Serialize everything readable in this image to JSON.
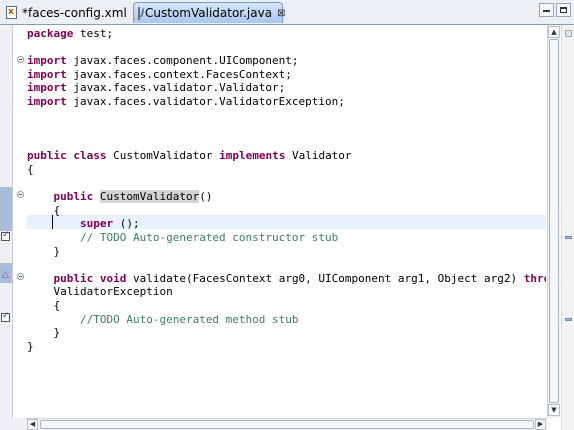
{
  "tabs": [
    {
      "label": "*faces-config.xml",
      "icon": "xml-file-icon",
      "active": false
    },
    {
      "label": "CustomValidator.java",
      "icon": "java-file-icon",
      "active": true,
      "close": "⊠"
    }
  ],
  "editor": {
    "lines": [
      [
        [
          "kw",
          "package"
        ],
        [
          "t",
          " test;"
        ]
      ],
      [],
      [
        [
          "kw",
          "import"
        ],
        [
          "t",
          " javax.faces.component.UIComponent;"
        ]
      ],
      [
        [
          "kw",
          "import"
        ],
        [
          "t",
          " javax.faces.context.FacesContext;"
        ]
      ],
      [
        [
          "kw",
          "import"
        ],
        [
          "t",
          " javax.faces.validator.Validator;"
        ]
      ],
      [
        [
          "kw",
          "import"
        ],
        [
          "t",
          " javax.faces.validator.ValidatorException;"
        ]
      ],
      [],
      [],
      [],
      [
        [
          "kw",
          "public"
        ],
        [
          "t",
          " "
        ],
        [
          "kw",
          "class"
        ],
        [
          "t",
          " CustomValidator "
        ],
        [
          "kw",
          "implements"
        ],
        [
          "t",
          " Validator"
        ]
      ],
      [
        [
          "t",
          "{"
        ]
      ],
      [],
      [
        [
          "t",
          "    "
        ],
        [
          "kw",
          "public"
        ],
        [
          "t",
          " "
        ],
        [
          "hl",
          "CustomValidator"
        ],
        [
          "t",
          "()"
        ]
      ],
      [
        [
          "t",
          "    {"
        ]
      ],
      [
        [
          "t",
          "        "
        ],
        [
          "kw",
          "super"
        ],
        [
          "t",
          " ();"
        ]
      ],
      [
        [
          "t",
          "        "
        ],
        [
          "cm",
          "// TODO Auto-generated constructor stub"
        ]
      ],
      [
        [
          "t",
          "    }"
        ]
      ],
      [],
      [
        [
          "t",
          "    "
        ],
        [
          "kw",
          "public"
        ],
        [
          "t",
          " "
        ],
        [
          "kw",
          "void"
        ],
        [
          "t",
          " validate(FacesContext arg0, UIComponent arg1, Object arg2) "
        ],
        [
          "kw",
          "throws"
        ]
      ],
      [
        [
          "t",
          "    ValidatorException"
        ]
      ],
      [
        [
          "t",
          "    {"
        ]
      ],
      [
        [
          "t",
          "        "
        ],
        [
          "cm",
          "//TODO Auto-generated method stub"
        ]
      ],
      [
        [
          "t",
          "    }"
        ]
      ],
      [
        [
          "t",
          "}"
        ]
      ]
    ]
  },
  "colors": {
    "keyword": "#7f0055",
    "comment": "#3f7f5f",
    "current_line": "#e8f2fe",
    "occurrence_highlight": "#d4d4d4"
  }
}
